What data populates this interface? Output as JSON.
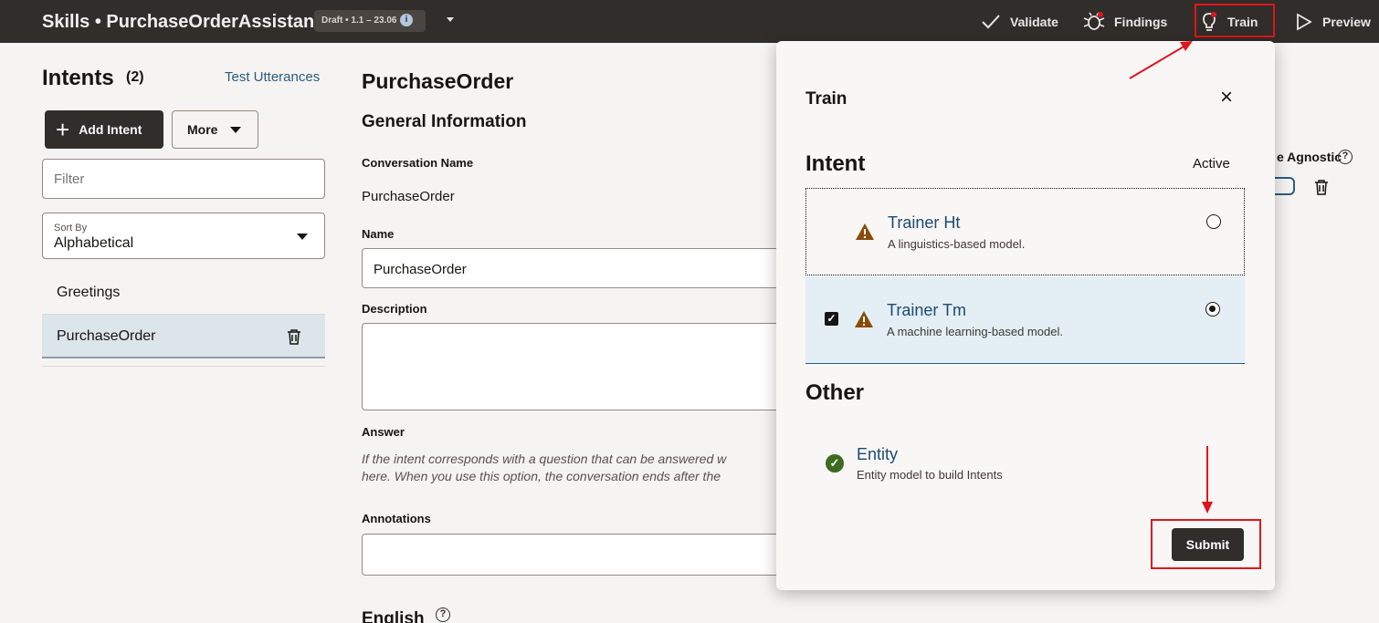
{
  "header": {
    "title": "Skills • PurchaseOrderAssistant",
    "version_badge": "Draft • 1.1 – 23.06",
    "info_glyph": "i",
    "actions": {
      "validate": "Validate",
      "findings": "Findings",
      "train": "Train",
      "preview": "Preview"
    }
  },
  "sidebar": {
    "title": "Intents",
    "count": "(2)",
    "test_utterances": "Test Utterances",
    "add_intent": "Add Intent",
    "more": "More",
    "filter_placeholder": "Filter",
    "sort_label": "Sort By",
    "sort_value": "Alphabetical",
    "intents": [
      {
        "label": "Greetings"
      },
      {
        "label": "PurchaseOrder"
      }
    ]
  },
  "main": {
    "title": "PurchaseOrder",
    "section": "General Information",
    "conversation_name_label": "Conversation Name",
    "conversation_name_value": "PurchaseOrder",
    "name_label": "Name",
    "name_value": "PurchaseOrder",
    "description_label": "Description",
    "answer_label": "Answer",
    "answer_help_1": "If the intent corresponds with a question that can be answered w",
    "answer_help_2": "here. When you use this option, the conversation ends after the",
    "annotations_label": "Annotations",
    "english_label": "English",
    "agnostic_label": "e Agnostic"
  },
  "modal": {
    "title": "Train",
    "close": "×",
    "intent_heading": "Intent",
    "active_label": "Active",
    "trainers": [
      {
        "name": "Trainer Ht",
        "description": "A linguistics-based model.",
        "selected": false,
        "checked": false
      },
      {
        "name": "Trainer Tm",
        "description": "A machine learning-based model.",
        "selected": true,
        "checked": true
      }
    ],
    "other_heading": "Other",
    "entity": {
      "name": "Entity",
      "description": "Entity model to build Intents"
    },
    "submit": "Submit"
  },
  "colors": {
    "topbar": "#312d2a",
    "link": "#1d4a72",
    "selected_row": "#e3eff5",
    "warning": "#8a4b08",
    "success": "#3d6b1f",
    "annotation": "#e0141e"
  }
}
